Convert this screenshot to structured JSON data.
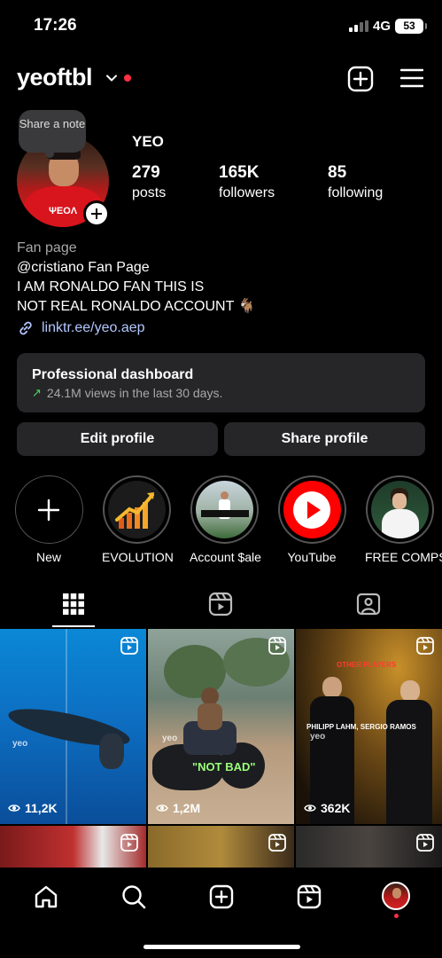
{
  "status": {
    "time": "17:26",
    "network": "4G",
    "battery": "53"
  },
  "header": {
    "username": "yeoftbl"
  },
  "profile": {
    "note": "Share a note",
    "display_name": "YEO",
    "stats": [
      {
        "value": "279",
        "label": "posts"
      },
      {
        "value": "165K",
        "label": "followers"
      },
      {
        "value": "85",
        "label": "following"
      }
    ],
    "category": "Fan page",
    "bio_lines": [
      "@cristiano Fan Page",
      "I AM RONALDO FAN THIS IS",
      "NOT REAL RONALDO ACCOUNT 🐐"
    ],
    "link": "linktr.ee/yeo.aep",
    "avatar_shirt_text": "ΨEOΛ"
  },
  "dashboard": {
    "title": "Professional dashboard",
    "subtitle": "24.1M views in the last 30 days."
  },
  "buttons": {
    "edit": "Edit profile",
    "share": "Share profile"
  },
  "highlights": [
    {
      "label": "New"
    },
    {
      "label": "EVOLUTION"
    },
    {
      "label": "Account $ale"
    },
    {
      "label": "YouTube"
    },
    {
      "label": "FREE COMPS"
    }
  ],
  "grid": [
    {
      "views": "11,2K",
      "watermark": "yeo"
    },
    {
      "views": "1,2M",
      "caption": "\"NOT BAD\"",
      "watermark": "yeo"
    },
    {
      "views": "362K",
      "top_caption": "OTHER PLAYERS",
      "caption": "PHILIPP LAHM, SERGIO RAMOS",
      "watermark": "yeo"
    }
  ],
  "colors": {
    "accent_link": "#b3c7ff",
    "notification_dot": "#ff3040",
    "trend_up": "#4cd964"
  },
  "icons": [
    "chevron-down-icon",
    "create-icon",
    "menu-icon",
    "link-icon",
    "grid-icon",
    "reels-icon",
    "tagged-icon",
    "home-icon",
    "search-icon",
    "reels-nav-icon",
    "eye-icon"
  ]
}
